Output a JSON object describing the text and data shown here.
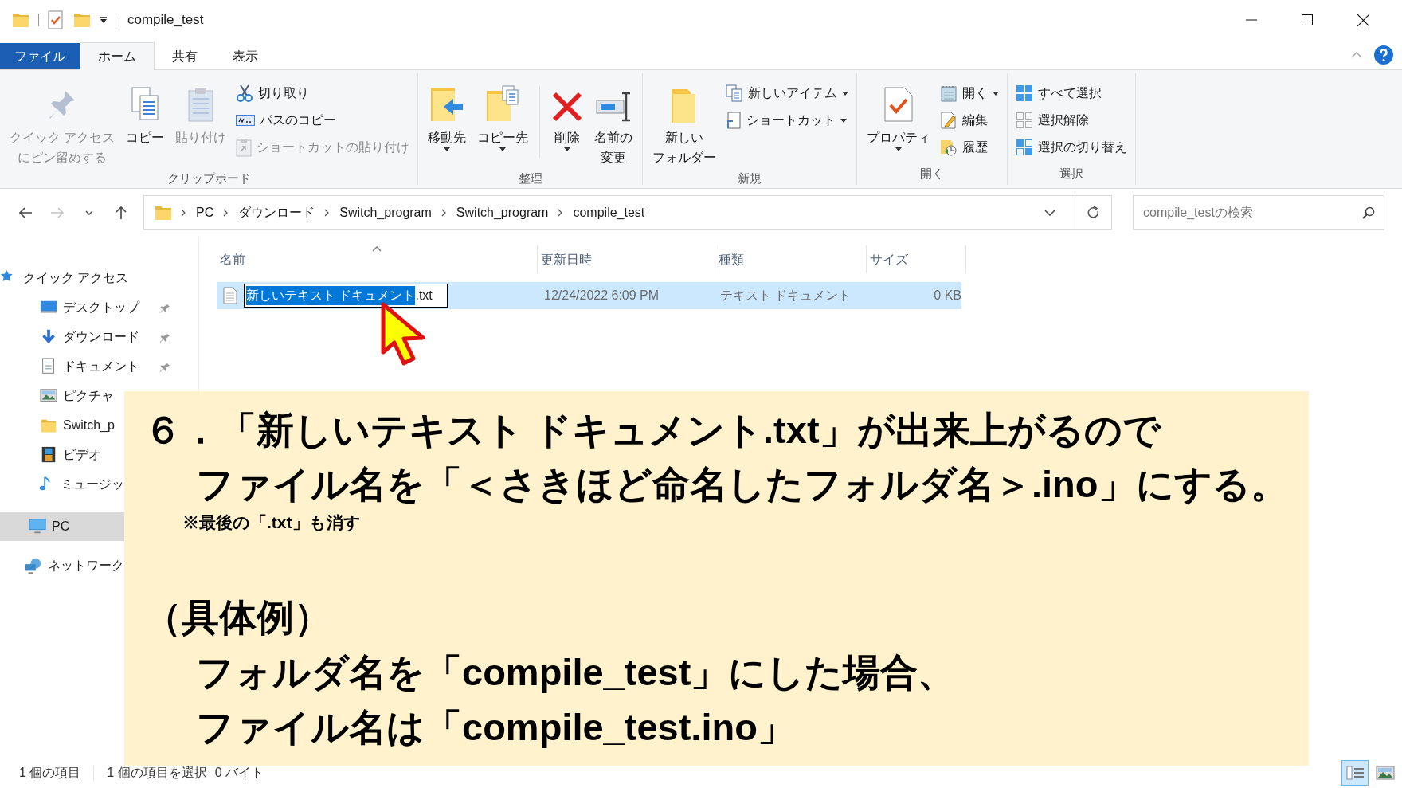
{
  "window": {
    "title": "compile_test"
  },
  "ribbon_tabs": [
    {
      "label": "ファイル",
      "kind": "file",
      "selected": false
    },
    {
      "label": "ホーム",
      "kind": "tab",
      "selected": true
    },
    {
      "label": "共有",
      "kind": "tab",
      "selected": false
    },
    {
      "label": "表示",
      "kind": "tab",
      "selected": false
    }
  ],
  "ribbon": {
    "groups": [
      {
        "label": "クリップボード",
        "columns": [
          {
            "kind": "large",
            "lines": [
              "クイック アクセス",
              "にピン留めする"
            ],
            "disabled": true,
            "dropdown": false
          },
          {
            "kind": "large",
            "lines": [
              "コピー"
            ],
            "disabled": false,
            "dropdown": false
          },
          {
            "kind": "large",
            "lines": [
              "貼り付け"
            ],
            "disabled": true,
            "dropdown": false
          },
          {
            "kind": "stack",
            "items": [
              {
                "label": "切り取り",
                "disabled": false,
                "dropdown": false
              },
              {
                "label": "パスのコピー",
                "disabled": false,
                "dropdown": false
              },
              {
                "label": "ショートカットの貼り付け",
                "disabled": true,
                "dropdown": false
              }
            ]
          }
        ]
      },
      {
        "label": "整理",
        "columns": [
          {
            "kind": "large",
            "lines": [
              "移動先"
            ],
            "disabled": false,
            "dropdown": true
          },
          {
            "kind": "large",
            "lines": [
              "コピー先"
            ],
            "disabled": false,
            "dropdown": true
          },
          {
            "kind": "separator"
          },
          {
            "kind": "large",
            "lines": [
              "削除"
            ],
            "disabled": false,
            "dropdown": true
          },
          {
            "kind": "large",
            "lines": [
              "名前の",
              "変更"
            ],
            "disabled": false,
            "dropdown": false
          }
        ]
      },
      {
        "label": "新規",
        "columns": [
          {
            "kind": "large",
            "lines": [
              "新しい",
              "フォルダー"
            ],
            "disabled": false,
            "dropdown": false
          },
          {
            "kind": "stack",
            "items": [
              {
                "label": "新しいアイテム",
                "disabled": false,
                "dropdown": true
              },
              {
                "label": "ショートカット",
                "disabled": false,
                "dropdown": true
              }
            ]
          }
        ]
      },
      {
        "label": "開く",
        "columns": [
          {
            "kind": "large",
            "lines": [
              "プロパティ"
            ],
            "disabled": false,
            "dropdown": true
          },
          {
            "kind": "stack",
            "items": [
              {
                "label": "開く",
                "disabled": false,
                "dropdown": true
              },
              {
                "label": "編集",
                "disabled": false,
                "dropdown": false
              },
              {
                "label": "履歴",
                "disabled": false,
                "dropdown": false
              }
            ]
          }
        ]
      },
      {
        "label": "選択",
        "columns": [
          {
            "kind": "stack",
            "items": [
              {
                "label": "すべて選択",
                "disabled": false,
                "dropdown": false
              },
              {
                "label": "選択解除",
                "disabled": false,
                "dropdown": false
              },
              {
                "label": "選択の切り替え",
                "disabled": false,
                "dropdown": false
              }
            ]
          }
        ]
      }
    ]
  },
  "nav_buttons": [
    {
      "kind": "back",
      "disabled": false
    },
    {
      "kind": "forward",
      "disabled": true
    },
    {
      "kind": "recent",
      "disabled": false
    },
    {
      "kind": "up",
      "disabled": false
    }
  ],
  "address_bar": {
    "crumbs": [
      "PC",
      "ダウンロード",
      "Switch_program",
      "Switch_program",
      "compile_test"
    ]
  },
  "search": {
    "placeholder": "compile_testの検索"
  },
  "sidebar": {
    "items": [
      {
        "label": "クイック アクセス",
        "selected": false,
        "children": [
          {
            "label": "デスクトップ",
            "pinned": true,
            "selected": false
          },
          {
            "label": "ダウンロード",
            "pinned": true,
            "selected": false
          },
          {
            "label": "ドキュメント",
            "pinned": true,
            "selected": false
          },
          {
            "label": "ピクチャ",
            "pinned": false,
            "selected": false
          },
          {
            "label": "Switch_p",
            "pinned": false,
            "selected": false
          },
          {
            "label": "ビデオ",
            "pinned": false,
            "selected": false
          },
          {
            "label": "ミュージッ",
            "pinned": false,
            "selected": false
          }
        ]
      },
      {
        "label": "PC",
        "selected": true
      },
      {
        "label": "ネットワーク",
        "selected": false
      }
    ]
  },
  "file_list": {
    "columns": [
      {
        "label": "名前",
        "sorted": true
      },
      {
        "label": "更新日時",
        "sorted": false
      },
      {
        "label": "種類",
        "sorted": false
      },
      {
        "label": "サイズ",
        "sorted": false
      }
    ],
    "rows": [
      {
        "name_selected": "新しいテキスト ドキュメント",
        "name_rest": ".txt",
        "renaming": true,
        "modified": "12/24/2022 6:09 PM",
        "type": "テキスト ドキュメント",
        "size": "0 KB",
        "selected": true
      }
    ]
  },
  "status_bar": {
    "item_count": "1 個の項目",
    "selection": "1 個の項目を選択",
    "selection_size": "0 バイト"
  },
  "view_buttons": [
    {
      "kind": "details",
      "selected": true
    },
    {
      "kind": "large_icons",
      "selected": false
    }
  ],
  "annotation": {
    "lines": [
      {
        "kind": "step",
        "text": "６．「新しいテキスト ドキュメント.txt」が出来上がるので"
      },
      {
        "kind": "step_cont",
        "text": "ファイル名を「＜さきほど命名したフォルダ名＞.ino」にする。"
      },
      {
        "kind": "footnote",
        "text": "※最後の「.txt」も消す"
      },
      {
        "kind": "example",
        "text": "（具体例）"
      },
      {
        "kind": "example_line",
        "text": "フォルダ名を「compile_test」にした場合、"
      },
      {
        "kind": "example_line",
        "text": "ファイル名は「compile_test.ino」"
      }
    ]
  }
}
